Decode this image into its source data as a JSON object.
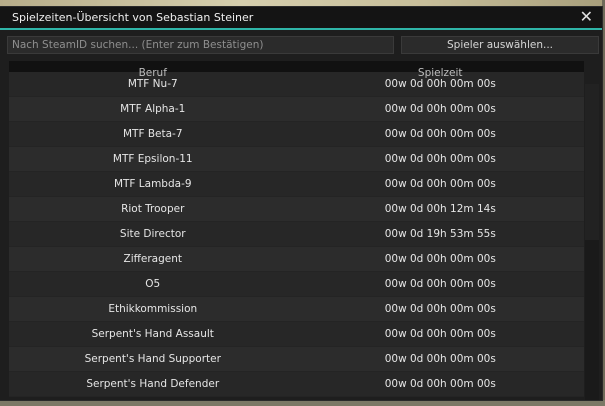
{
  "window": {
    "title": "Spielzeiten-Übersicht von Sebastian Steiner",
    "close_symbol": "✕"
  },
  "search": {
    "placeholder": "Nach SteamID suchen... (Enter zum Bestätigen)",
    "value": ""
  },
  "select_player_label": "Spieler auswählen...",
  "table": {
    "columns": [
      "Beruf",
      "Spielzeit"
    ],
    "rows": [
      [
        "MTF Nu-7",
        "00w 0d 00h 00m 00s"
      ],
      [
        "MTF Alpha-1",
        "00w 0d 00h 00m 00s"
      ],
      [
        "MTF Beta-7",
        "00w 0d 00h 00m 00s"
      ],
      [
        "MTF Epsilon-11",
        "00w 0d 00h 00m 00s"
      ],
      [
        "MTF Lambda-9",
        "00w 0d 00h 00m 00s"
      ],
      [
        "Riot Trooper",
        "00w 0d 00h 12m 14s"
      ],
      [
        "Site Director",
        "00w 0d 19h 53m 55s"
      ],
      [
        "Zifferagent",
        "00w 0d 00h 00m 00s"
      ],
      [
        "O5",
        "00w 0d 00h 00m 00s"
      ],
      [
        "Ethikkommission",
        "00w 0d 00h 00m 00s"
      ],
      [
        "Serpent's Hand Assault",
        "00w 0d 00h 00m 00s"
      ],
      [
        "Serpent's Hand Supporter",
        "00w 0d 00h 00m 00s"
      ],
      [
        "Serpent's Hand Defender",
        "00w 0d 00h 00m 00s"
      ]
    ]
  }
}
